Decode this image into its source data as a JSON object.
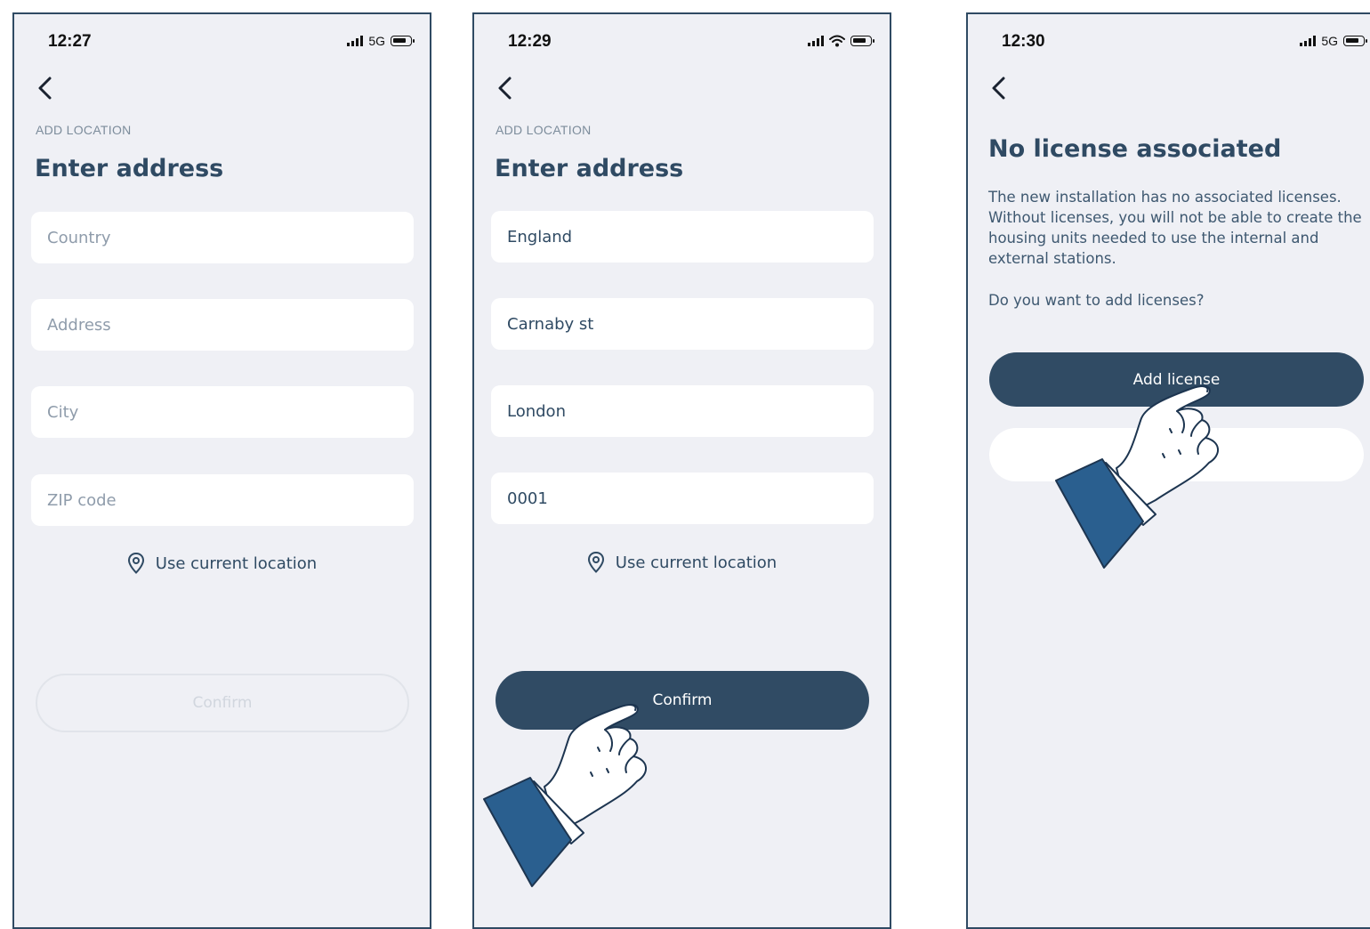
{
  "screens": [
    {
      "time": "12:27",
      "network": "5G",
      "overline": "ADD LOCATION",
      "title": "Enter address",
      "fields": [
        {
          "placeholder": "Country"
        },
        {
          "placeholder": "Address"
        },
        {
          "placeholder": "City"
        },
        {
          "placeholder": "ZIP code"
        }
      ],
      "use_location": "Use current location",
      "confirm": "Confirm"
    },
    {
      "time": "12:29",
      "overline": "ADD LOCATION",
      "title": "Enter address",
      "fields": [
        {
          "value": "England"
        },
        {
          "value": "Carnaby st"
        },
        {
          "value": "London"
        },
        {
          "value": "0001"
        }
      ],
      "use_location": "Use current location",
      "confirm": "Confirm"
    },
    {
      "time": "12:30",
      "network": "5G",
      "title": "No license associated",
      "body": "The new installation has no associated licenses. Without licenses, you will not be able to create the housing units needed to use the internal and external stations.",
      "question": "Do you want to add licenses?",
      "add_license": "Add license",
      "secondary": ""
    }
  ],
  "colors": {
    "primary": "#304b64",
    "screen_bg": "#eff0f5",
    "field_bg": "#ffffff",
    "placeholder": "#8f9cab",
    "hand_sleeve": "#2a5f8f"
  },
  "icons": [
    "back-chevron-icon",
    "location-pin-icon",
    "signal-icon",
    "wifi-icon",
    "battery-icon",
    "pointing-hand-icon"
  ]
}
